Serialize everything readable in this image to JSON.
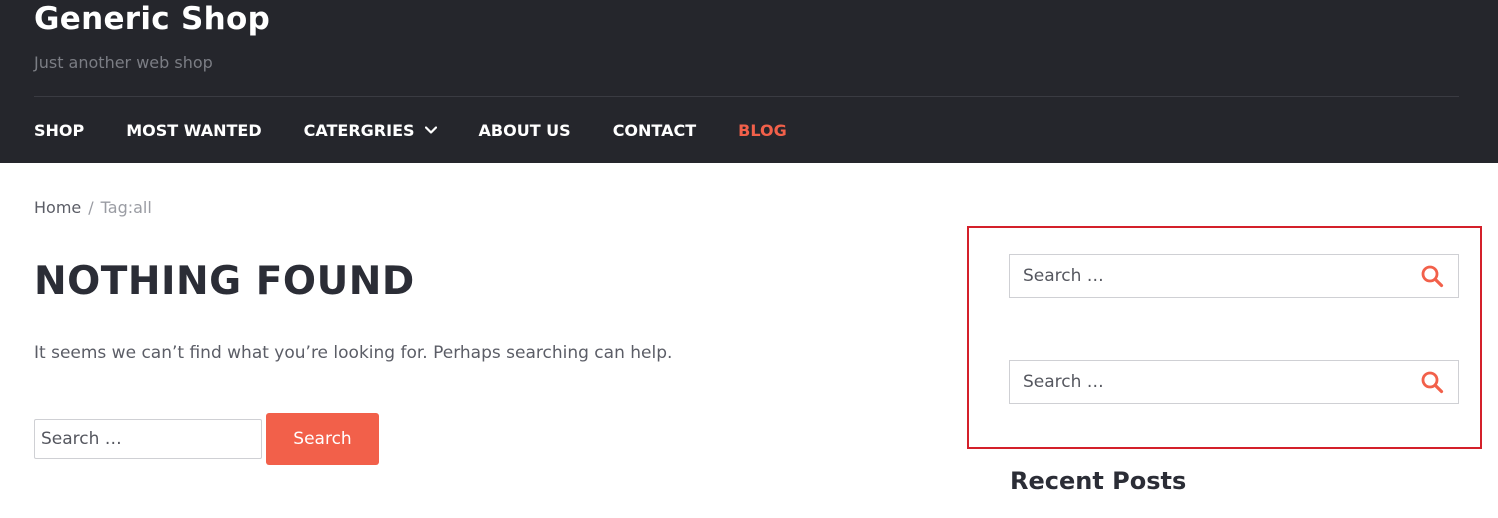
{
  "site": {
    "title": "Generic Shop",
    "tagline": "Just another web shop"
  },
  "nav": {
    "items": [
      {
        "label": "SHOP",
        "active": false,
        "has_dropdown": false
      },
      {
        "label": "MOST WANTED",
        "active": false,
        "has_dropdown": false
      },
      {
        "label": "CATERGRIES",
        "active": false,
        "has_dropdown": true
      },
      {
        "label": "ABOUT US",
        "active": false,
        "has_dropdown": false
      },
      {
        "label": "CONTACT",
        "active": false,
        "has_dropdown": false
      },
      {
        "label": "BLOG",
        "active": true,
        "has_dropdown": false
      }
    ]
  },
  "breadcrumb": {
    "home": "Home",
    "separator": "/",
    "current": "Tag:all"
  },
  "main": {
    "title": "NOTHING FOUND",
    "message": "It seems we can’t find what you’re looking for. Perhaps searching can help.",
    "search_placeholder": "Search …",
    "search_button": "Search"
  },
  "sidebar": {
    "search_1": {
      "placeholder": "Search …",
      "icon": "search-icon"
    },
    "search_2": {
      "placeholder": "Search …",
      "icon": "search-icon"
    },
    "recent_posts_title": "Recent Posts"
  },
  "colors": {
    "header_bg": "#25262c",
    "accent": "#f2604a",
    "highlight_border": "#d4202a"
  }
}
